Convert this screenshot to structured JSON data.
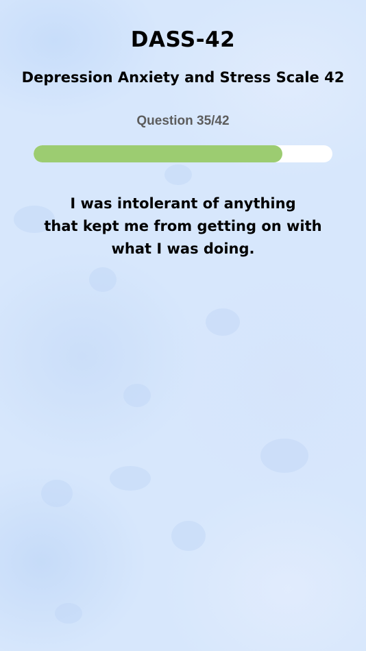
{
  "header": {
    "title": "DASS-42",
    "subtitle": "Depression Anxiety and Stress Scale 42"
  },
  "progress": {
    "label": "Question 35/42",
    "current": 35,
    "total": 42,
    "fraction": 0.8333
  },
  "question": {
    "lines": [
      "I was intolerant of anything",
      "that kept me from getting on with",
      "what I was doing."
    ]
  },
  "colors": {
    "progress_fill": "#9ccc71",
    "progress_track": "#ffffff",
    "background": "#d7e7fc",
    "counter_text": "#5c5c5c"
  }
}
